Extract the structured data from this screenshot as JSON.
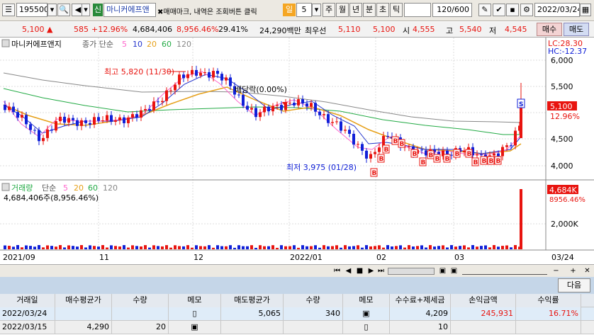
{
  "toolbar": {
    "code": "195500",
    "credit_badge": "신",
    "name": "마니커에프앤",
    "notice": "✖매매마크, 내역은 조회버튼 클릭",
    "period_badge": "일",
    "period_value": "5",
    "tabs": [
      "주",
      "월",
      "년",
      "분",
      "초",
      "틱"
    ],
    "count": "120/600",
    "date": "2022/03/24"
  },
  "quote": {
    "price": "5,100",
    "arrow": "▲",
    "change": "585",
    "change_pct": "+12.96%",
    "volume": "4,684,406",
    "vol_ratio": "8,956.46%",
    "turnover": "29.41%",
    "amount": "24,290백만",
    "best_ask_label": "최우선",
    "best_ask": "5,110",
    "best_bid": "5,100",
    "open_label": "시",
    "open": "4,555",
    "high_label": "고",
    "high": "5,540",
    "low_label": "저",
    "low": "4,545",
    "buy_btn": "매수",
    "sell_btn": "매도"
  },
  "price_pane": {
    "stock_label": "마니커에프앤지",
    "ma_label": "종가 단순",
    "ma_periods": [
      "5",
      "10",
      "20",
      "60",
      "120"
    ],
    "lc": "LC:28.30",
    "hc": "HC:-12.37",
    "yaxis": [
      "6,000",
      "5,500",
      "5,000",
      "4,500",
      "4,000"
    ],
    "current_price": "5,100",
    "current_pct": "12.96%",
    "high_note": "최고 5,820 (11/30)",
    "low_note": "최저 3,975 (01/28)",
    "dividend_note": "배당락(0.00%)"
  },
  "volume_pane": {
    "label": "거래량",
    "ma_label": "단순",
    "ma_periods": [
      "5",
      "20",
      "60",
      "120"
    ],
    "value_line": "4,684,406주(8,956.46%)",
    "current_value": "4,684K",
    "current_pct": "8956.46%",
    "yaxis": [
      "2,000K"
    ]
  },
  "xaxis": [
    "2021/09",
    "11",
    "12",
    "2022/01",
    "02",
    "03",
    "03/24"
  ],
  "table": {
    "next_btn": "다음",
    "headers": [
      "거래일",
      "매수평균가",
      "수량",
      "메모",
      "매도평균가",
      "수량",
      "메모",
      "수수료+제세금",
      "손익금액",
      "수익률"
    ],
    "rows": [
      [
        "2022/03/24",
        "",
        "",
        "",
        "5,065",
        "340",
        "",
        "4,209",
        "245,931",
        "16.71%"
      ],
      [
        "2022/03/15",
        "4,290",
        "20",
        "",
        "",
        "",
        "",
        "10",
        "",
        ""
      ]
    ]
  },
  "colors": {
    "up": "#e8140f",
    "down": "#1020d8",
    "ma5": "#ff66cc",
    "ma10": "#2233cc",
    "ma20": "#e6a019",
    "ma60": "#22aa44",
    "ma120": "#888888"
  }
}
